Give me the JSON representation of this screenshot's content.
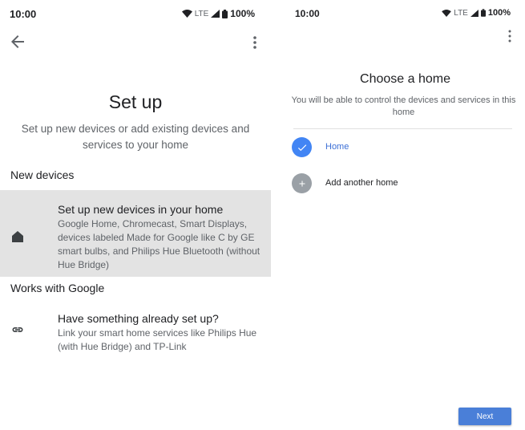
{
  "left": {
    "status": {
      "time": "10:00",
      "network": "LTE",
      "battery": "100%"
    },
    "title": "Set up",
    "subtitle": "Set up new devices or add existing devices and services to your home",
    "sections": {
      "new_devices": "New devices",
      "works_with_google": "Works with Google"
    },
    "options": {
      "new": {
        "title": "Set up new devices in your home",
        "description": "Google Home, Chromecast, Smart Displays, devices labeled Made for Google like C by GE smart bulbs, and Philips Hue Bluetooth (without Hue Bridge)",
        "icon": "home-icon"
      },
      "existing": {
        "title": "Have something already set up?",
        "description": "Link your smart home services like Philips Hue (with Hue Bridge) and TP-Link",
        "icon": "link-icon"
      }
    }
  },
  "right": {
    "status": {
      "time": "10:00",
      "network": "LTE",
      "battery": "100%"
    },
    "title": "Choose a home",
    "subtitle": "You will be able to control the devices and services in this home",
    "homes": [
      {
        "label": "Home",
        "selected": true,
        "icon": "check-icon"
      },
      {
        "label": "Add another home",
        "icon": "plus-icon"
      }
    ],
    "next_label": "Next"
  },
  "colors": {
    "accent": "#4285f4",
    "selected_bg": "#e3e3e3",
    "button": "#4a7fd8"
  }
}
